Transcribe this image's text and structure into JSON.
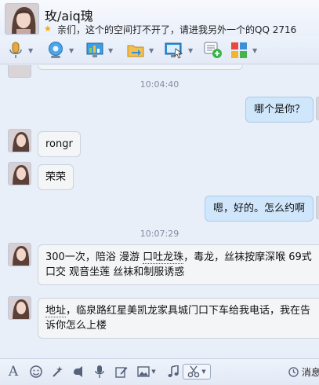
{
  "header": {
    "contact_name": "玫/aiq瑰",
    "signature": "亲们，这个的空间打不开了，请进我另外一个的QQ 2716"
  },
  "toolbar": {
    "tools": [
      "microphone-icon",
      "webcam-icon",
      "screen-share-icon",
      "file-transfer-icon",
      "remote-assist-icon",
      "message-plus-icon",
      "apps-grid-icon"
    ]
  },
  "chat": {
    "timestamps": [
      "10:04:40",
      "10:07:29"
    ],
    "messages": [
      {
        "side": "out",
        "text": "哪个是你？"
      },
      {
        "side": "in",
        "text": "rongr"
      },
      {
        "side": "in",
        "text": "荣荣"
      },
      {
        "side": "out",
        "text": "嗯，好的。怎么约啊"
      },
      {
        "side": "in",
        "text_parts": [
          "300一次，陪浴 漫游 ",
          "口吐龙珠",
          "，毒龙，丝袜按摩深喉 69式 口交 观音坐莲 丝袜和制服诱惑"
        ]
      },
      {
        "side": "in",
        "text_parts": [
          "地址",
          "，临泉路红星美凯龙家具城门口下车给我电话，我在告诉你怎么上楼"
        ]
      }
    ]
  },
  "bottombar": {
    "tools": [
      "font-icon",
      "emoji-icon",
      "magic-wand-icon",
      "voice-icon",
      "edit-icon",
      "image-icon",
      "music-icon",
      "scissors-icon"
    ],
    "history_label": "消息"
  }
}
